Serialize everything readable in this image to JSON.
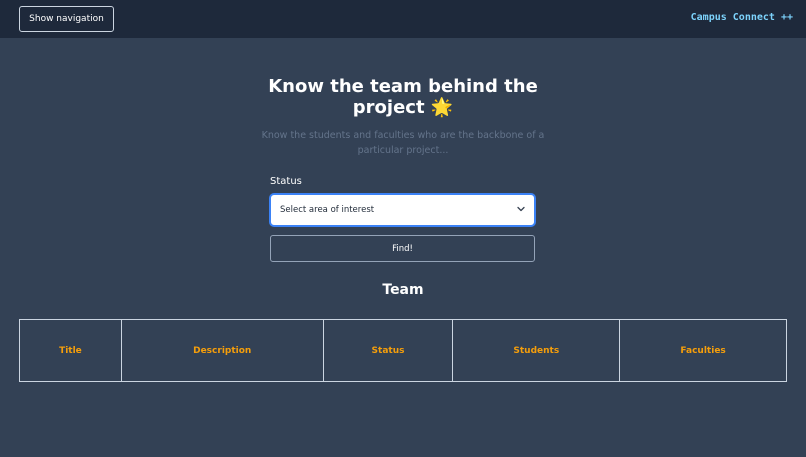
{
  "header": {
    "nav_button_label": "Show navigation",
    "brand": "Campus Connect ++"
  },
  "hero": {
    "title": "Know the team behind the project 🌟",
    "subtitle": "Know the students and faculties who are the backbone of a particular project..."
  },
  "form": {
    "status_label": "Status",
    "select_value": "Select area of interest",
    "find_button_label": "Find!"
  },
  "team": {
    "heading": "Team",
    "columns": [
      "Title",
      "Description",
      "Status",
      "Students",
      "Faculties"
    ]
  },
  "colors": {
    "background": "#334155",
    "topbar": "#1e293b",
    "brand": "#7dd3fc",
    "column_header": "#f59e0b",
    "select_focus": "#3b82f6"
  },
  "icons": {
    "select_chevron": "chevron-down-icon"
  }
}
